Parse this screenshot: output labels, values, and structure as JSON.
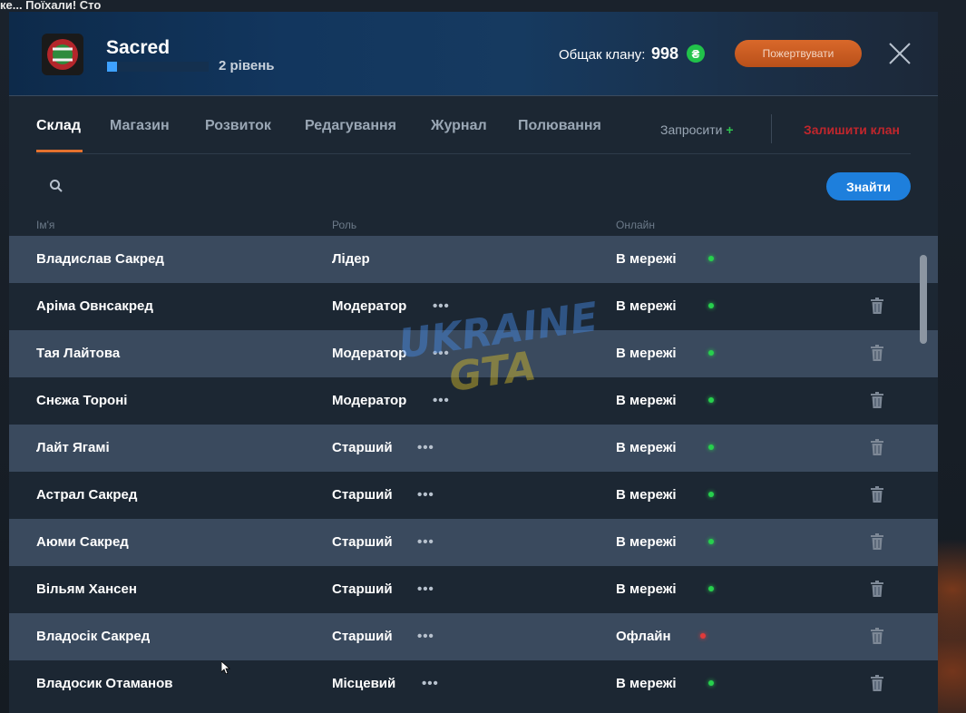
{
  "chat": {
    "line": "ке... Поїхали! Сто"
  },
  "header": {
    "clan_name": "Sacred",
    "level_text": "2 рівень",
    "level_progress": 0.1,
    "funds_label": "Общак клану:",
    "funds_value": "998",
    "currency_symbol": "₴",
    "donate_label": "Пожертвувати"
  },
  "tabs": [
    {
      "label": "Склад",
      "active": true
    },
    {
      "label": "Магазин"
    },
    {
      "label": "Розвиток"
    },
    {
      "label": "Редагування"
    },
    {
      "label": "Журнал"
    },
    {
      "label": "Полювання"
    }
  ],
  "actions": {
    "invite_label": "Запросити",
    "invite_plus": "+",
    "leave_label": "Залишити клан"
  },
  "search": {
    "placeholder": "",
    "button_label": "Знайти"
  },
  "columns": {
    "name": "Ім'я",
    "role": "Роль",
    "online": "Онлайн"
  },
  "members": [
    {
      "name": "Владислав Сакред",
      "role": "Лідер",
      "status": "В мережі",
      "online": true,
      "menu": false,
      "delete": false
    },
    {
      "name": "Аріма Овнсакред",
      "role": "Модератор",
      "status": "В мережі",
      "online": true,
      "menu": true,
      "delete": true
    },
    {
      "name": "Тая Лайтова",
      "role": "Модератор",
      "status": "В мережі",
      "online": true,
      "menu": true,
      "delete": true
    },
    {
      "name": "Снєжа Тороні",
      "role": "Модератор",
      "status": "В мережі",
      "online": true,
      "menu": true,
      "delete": true
    },
    {
      "name": "Лайт Ягамі",
      "role": "Старший",
      "status": "В мережі",
      "online": true,
      "menu": true,
      "delete": true
    },
    {
      "name": "Астрал Сакред",
      "role": "Старший",
      "status": "В мережі",
      "online": true,
      "menu": true,
      "delete": true
    },
    {
      "name": "Аюми Сакред",
      "role": "Старший",
      "status": "В мережі",
      "online": true,
      "menu": true,
      "delete": true
    },
    {
      "name": "Вільям Хансен",
      "role": "Старший",
      "status": "В мережі",
      "online": true,
      "menu": true,
      "delete": true
    },
    {
      "name": "Владосік Сакред",
      "role": "Старший",
      "status": "Офлайн",
      "online": false,
      "menu": true,
      "delete": true
    },
    {
      "name": "Владосик Отаманов",
      "role": "Місцевий",
      "status": "В мережі",
      "online": true,
      "menu": true,
      "delete": true
    }
  ],
  "watermark": {
    "line1": "UKRAINE",
    "line2": "GTA"
  },
  "colors": {
    "accent": "#e4712e",
    "primary": "#1e7fdc",
    "online": "#27d04d",
    "offline": "#e03a3a",
    "danger": "#c0262c"
  }
}
